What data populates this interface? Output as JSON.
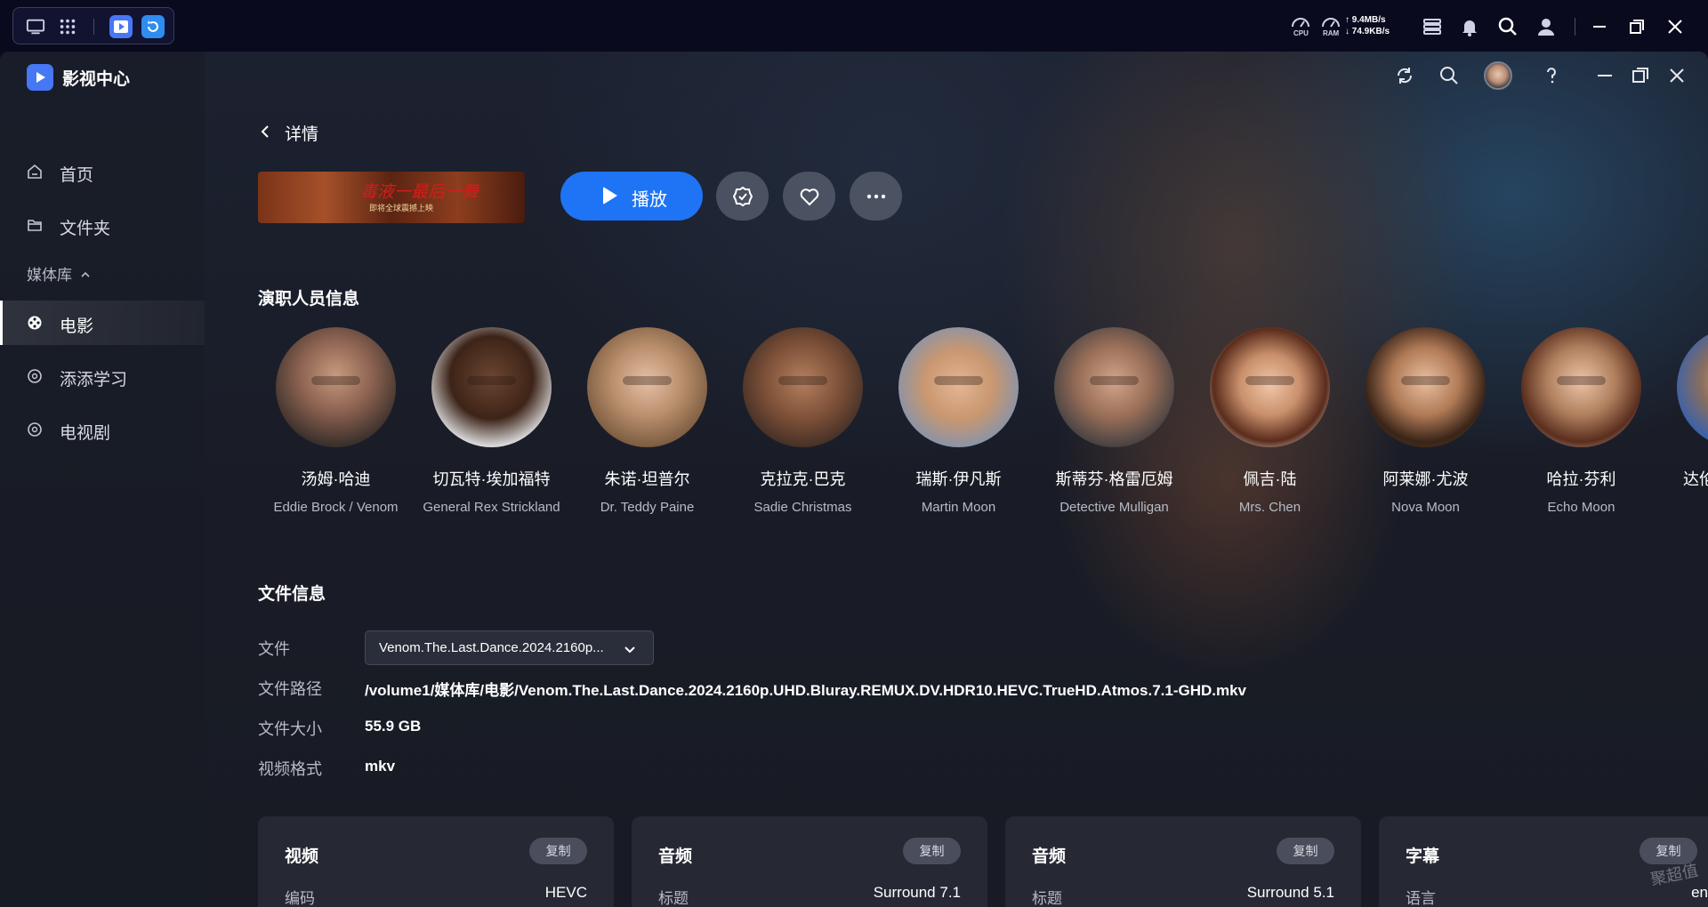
{
  "os": {
    "network": {
      "up": "9.4MB/s",
      "down": "74.9KB/s"
    },
    "gauges": {
      "cpu": "CPU",
      "ram": "RAM"
    }
  },
  "app": {
    "title": "影视中心"
  },
  "sidebar": {
    "items": [
      {
        "label": "首页",
        "icon": "home-icon"
      },
      {
        "label": "文件夹",
        "icon": "folder-icon"
      }
    ],
    "section_label": "媒体库",
    "library": [
      {
        "label": "电影",
        "icon": "film-reel-icon",
        "active": true
      },
      {
        "label": "添添学习",
        "icon": "film-reel-icon"
      },
      {
        "label": "电视剧",
        "icon": "film-reel-icon"
      }
    ]
  },
  "header": {
    "back_label": "详情"
  },
  "poster": {
    "title": "毒液一最后一舞",
    "subtitle": "即将全球震撼上映"
  },
  "actions": {
    "play_label": "播放"
  },
  "cast_section": {
    "title": "演职人员信息"
  },
  "cast": [
    {
      "name": "汤姆·哈迪",
      "role": "Eddie Brock / Venom"
    },
    {
      "name": "切瓦特·埃加福特",
      "role": "General Rex Strickland"
    },
    {
      "name": "朱诺·坦普尔",
      "role": "Dr. Teddy Paine"
    },
    {
      "name": "克拉克·巴克",
      "role": "Sadie Christmas"
    },
    {
      "name": "瑞斯·伊凡斯",
      "role": "Martin Moon"
    },
    {
      "name": "斯蒂芬·格雷厄姆",
      "role": "Detective Mulligan"
    },
    {
      "name": "佩吉·陆",
      "role": "Mrs. Chen"
    },
    {
      "name": "阿莱娜·尤波",
      "role": "Nova Moon"
    },
    {
      "name": "哈拉·芬利",
      "role": "Echo Moon"
    },
    {
      "name": "达伦",
      "role": ""
    }
  ],
  "file_section": {
    "title": "文件信息",
    "rows": {
      "file_label": "文件",
      "file_value": "Venom.The.Last.Dance.2024.2160p...",
      "path_label": "文件路径",
      "path_value": "/volume1/媒体库/电影/Venom.The.Last.Dance.2024.2160p.UHD.Bluray.REMUX.DV.HDR10.HEVC.TrueHD.Atmos.7.1-GHD.mkv",
      "size_label": "文件大小",
      "size_value": "55.9 GB",
      "format_label": "视频格式",
      "format_value": "mkv"
    }
  },
  "cards": [
    {
      "title": "视频",
      "copy": "复制",
      "key": "编码",
      "value": "HEVC"
    },
    {
      "title": "音频",
      "copy": "复制",
      "key": "标题",
      "value": "Surround 7.1"
    },
    {
      "title": "音频",
      "copy": "复制",
      "key": "标题",
      "value": "Surround 5.1"
    },
    {
      "title": "字幕",
      "copy": "复制",
      "key": "语言",
      "value": "en"
    }
  ],
  "watermark": "聚超值",
  "colors": {
    "accent": "#1e74f5",
    "window_bg": "#181b24",
    "os_bar": "#090a1e"
  }
}
